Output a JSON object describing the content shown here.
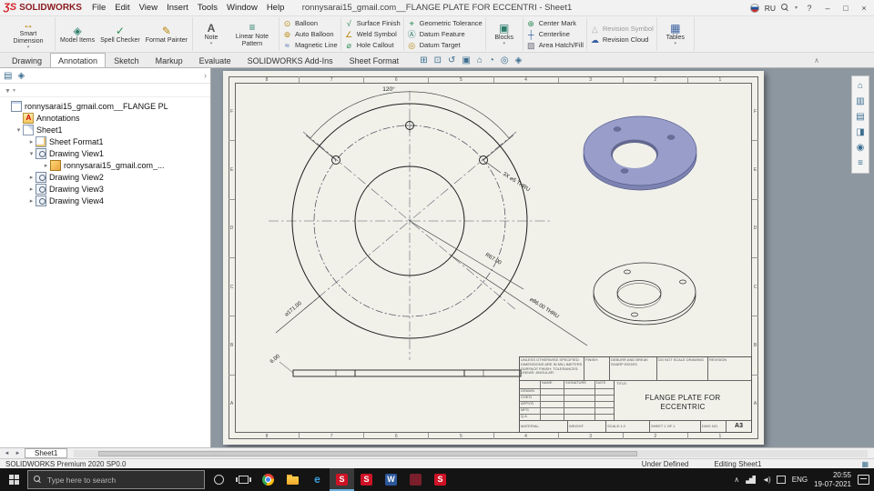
{
  "titlebar": {
    "brand": "SOLIDWORKS",
    "menus": [
      "File",
      "Edit",
      "View",
      "Insert",
      "Tools",
      "Window",
      "Help"
    ],
    "doc_title": "ronnysarai15_gmail.com__FLANGE PLATE FOR ECCENTRI - Sheet1",
    "lang": "RU",
    "help": "?",
    "min": "–",
    "max": "□",
    "close": "×"
  },
  "ribbon": {
    "smart_dimension": "Smart Dimension",
    "model_items": "Model Items",
    "spell_checker": "Spell Checker",
    "format_painter": "Format Painter",
    "note": "Note",
    "linear_note_pattern": "Linear Note Pattern",
    "balloon": "Balloon",
    "auto_balloon": "Auto Balloon",
    "magnetic_line": "Magnetic Line",
    "surface_finish": "Surface Finish",
    "weld_symbol": "Weld Symbol",
    "hole_callout": "Hole Callout",
    "geometric_tolerance": "Geometric Tolerance",
    "datum_feature": "Datum Feature",
    "datum_target": "Datum Target",
    "blocks": "Blocks",
    "center_mark": "Center Mark",
    "centerline": "Centerline",
    "area_hatch": "Area Hatch/Fill",
    "revision_symbol": "Revision Symbol",
    "revision_cloud": "Revision Cloud",
    "tables": "Tables"
  },
  "tabs": [
    {
      "label": "Drawing"
    },
    {
      "label": "Annotation",
      "cls": "active"
    },
    {
      "label": "Sketch"
    },
    {
      "label": "Markup"
    },
    {
      "label": "Evaluate"
    },
    {
      "label": "SOLIDWORKS Add-Ins"
    },
    {
      "label": "Sheet Format"
    }
  ],
  "headsup": [
    {
      "name": "zoom-fit-icon",
      "cls": "h1"
    },
    {
      "name": "zoom-area-icon",
      "cls": "h2"
    },
    {
      "name": "previous-view-icon",
      "cls": "h3"
    },
    {
      "name": "section-view-icon",
      "cls": "h4"
    },
    {
      "name": "view-orientation-icon",
      "cls": "h5"
    },
    {
      "name": "display-style-icon",
      "cls": "h6"
    },
    {
      "name": "hide-show-icon",
      "cls": "h7"
    },
    {
      "name": "view-settings-icon",
      "cls": "h8"
    }
  ],
  "sidebar": {
    "tree": [
      {
        "arrow": "",
        "icon": "i-drawdoc",
        "ind": "ind0",
        "label": "ronnysarai15_gmail.com__FLANGE PL"
      },
      {
        "arrow": "",
        "icon": "i-ann",
        "ind": "ind1",
        "label": "Annotations"
      },
      {
        "arrow": "▾",
        "icon": "i-sheet",
        "ind": "ind1",
        "label": "Sheet1"
      },
      {
        "arrow": "▸",
        "icon": "i-format",
        "ind": "ind2",
        "label": "Sheet Format1"
      },
      {
        "arrow": "▾",
        "icon": "i-view",
        "ind": "ind2",
        "label": "Drawing View1"
      },
      {
        "arrow": "▸",
        "icon": "i-part",
        "ind": "ind3",
        "label": "ronnysarai15_gmail.com_..."
      },
      {
        "arrow": "▸",
        "icon": "i-view",
        "ind": "ind2",
        "label": "Drawing View2"
      },
      {
        "arrow": "▸",
        "icon": "i-view",
        "ind": "ind2",
        "label": "Drawing View3"
      },
      {
        "arrow": "▸",
        "icon": "i-view",
        "ind": "ind2",
        "label": "Drawing View4"
      }
    ]
  },
  "sheet": {
    "zones_h": [
      "8",
      "7",
      "6",
      "5",
      "4",
      "3",
      "2",
      "1"
    ],
    "zones_v": [
      "F",
      "E",
      "D",
      "C",
      "B",
      "A"
    ]
  },
  "drawing": {
    "dims": {
      "angle": "120°",
      "holes": "3X ⌀5 THRU",
      "radius": "R67.00",
      "outer_dia": "⌀171.00",
      "bore": "⌀86.00 THRU",
      "thickness": "6.00"
    }
  },
  "titleblock": {
    "small_note": "UNLESS OTHERWISE SPECIFIED: DIMENSIONS ARE IN MILLIMETERS SURFACE FINISH: TOLERANCES: LINEAR: ANGULAR:",
    "finish": "FINISH:",
    "deburr": "DEBURR AND BREAK SHARP EDGES",
    "do_not_scale": "DO NOT SCALE DRAWING",
    "revision": "REVISION",
    "name": "NAME",
    "signature": "SIGNATURE",
    "date": "DATE",
    "rows": [
      "DRAWN",
      "CHK'D",
      "APPV'D",
      "MFG",
      "Q.A"
    ],
    "title_label": "TITLE:",
    "title_line1": "FLANGE PLATE FOR",
    "title_line2": "ECCENTRIC",
    "material": "MATERIAL:",
    "weight": "WEIGHT:",
    "scale": "SCALE:1:2",
    "sheet": "SHEET 1 OF 1",
    "dwg_label": "DWG NO.",
    "size": "A3"
  },
  "taskpane": [
    {
      "name": "resources-icon",
      "cls": "p1"
    },
    {
      "name": "design-library-icon",
      "cls": "p2"
    },
    {
      "name": "file-explorer-icon",
      "cls": "p3"
    },
    {
      "name": "view-palette-icon",
      "cls": "p4"
    },
    {
      "name": "appearances-icon",
      "cls": "p5"
    },
    {
      "name": "custom-properties-icon",
      "cls": "p6"
    }
  ],
  "sheettab": {
    "label": "Sheet1"
  },
  "statusbar": {
    "product": "SOLIDWORKS Premium 2020 SP0.0",
    "state": "Under Defined",
    "editing": "Editing Sheet1"
  },
  "taskbar": {
    "search": "Type here to search",
    "icons": [
      {
        "name": "cortana-icon",
        "cls": "tb-cortana"
      },
      {
        "name": "task-view-icon",
        "cls": "tb-taskview"
      },
      {
        "name": "chrome-icon",
        "cls": "tb-chrome"
      },
      {
        "name": "file-explorer-icon",
        "cls": "tb-folder"
      },
      {
        "name": "edge-icon",
        "cls": "tb-edge"
      },
      {
        "name": "solidworks-icon",
        "cls": "tb-sw",
        "wrap": "active"
      },
      {
        "name": "solidworks-icon",
        "cls": "tb-sw"
      },
      {
        "name": "word-icon",
        "cls": "tb-blue"
      },
      {
        "name": "app-icon",
        "cls": "tb-darkred"
      },
      {
        "name": "solidworks-icon",
        "cls": "tb-sw"
      }
    ],
    "tray_lang": "ENG",
    "time": "20:55",
    "date": "19-07-2021"
  }
}
